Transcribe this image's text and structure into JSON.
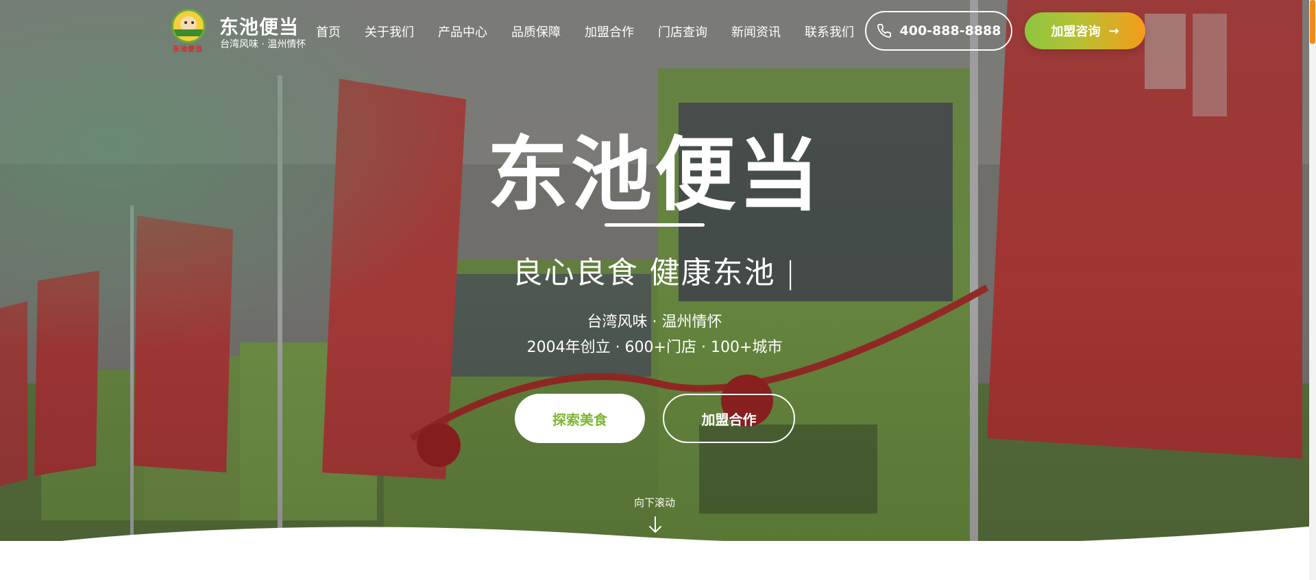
{
  "brand": {
    "name": "东池便当",
    "tagline": "台湾风味 · 温州情怀",
    "logo_text": "东池便当"
  },
  "nav": {
    "items": [
      "首页",
      "关于我们",
      "产品中心",
      "品质保障",
      "加盟合作",
      "门店查询",
      "新闻资讯",
      "联系我们"
    ]
  },
  "header_actions": {
    "phone": "400-888-8888",
    "join_label": "加盟咨询",
    "join_arrow": "→"
  },
  "hero": {
    "title": "东池便当",
    "slogan": "良心良食 健康东池",
    "slogan_cursor": "|",
    "line1": "台湾风味 · 温州情怀",
    "line2": "2004年创立 · 600+门店 · 100+城市",
    "explore_label": "探索美食",
    "franchise_label": "加盟合作",
    "scroll_label": "向下滚动"
  },
  "colors": {
    "accent_green": "#7cb82f",
    "accent_orange": "#f59b19",
    "text_light": "#ffffff"
  },
  "icons": {
    "phone": "phone-icon",
    "arrow_right": "arrow-right-icon",
    "scroll_down": "arrow-down-icon"
  }
}
